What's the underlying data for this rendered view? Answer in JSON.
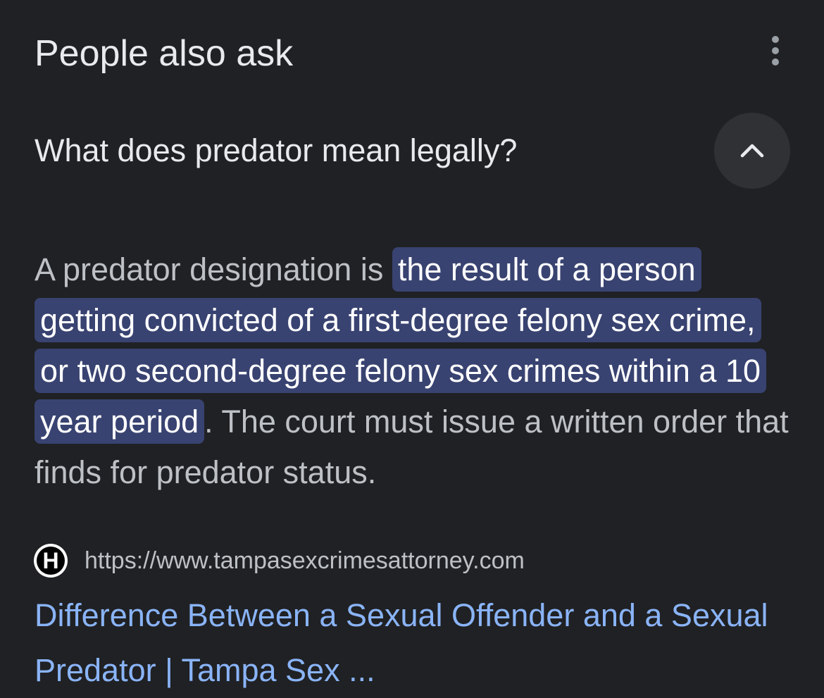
{
  "header": {
    "title": "People also ask",
    "more_icon": "more-vert-icon"
  },
  "question": {
    "text": "What does predator mean legally?",
    "expanded": true,
    "toggle_icon": "chevron-up-icon"
  },
  "answer": {
    "prefix": "A predator designation is ",
    "highlight": "the result of a person getting convicted of a first-degree felony sex crime, or two second-degree felony sex crimes within a 10 year period",
    "suffix": ". The court must issue a written order that finds for predator status.",
    "highlight_color": "#394371"
  },
  "source": {
    "favicon_letter": "H",
    "url": "https://www.tampasexcrimesattorney.com",
    "title": "Difference Between a Sexual Offender and a Sexual Predator | Tampa Sex ...",
    "link_color": "#8ab4f8"
  }
}
